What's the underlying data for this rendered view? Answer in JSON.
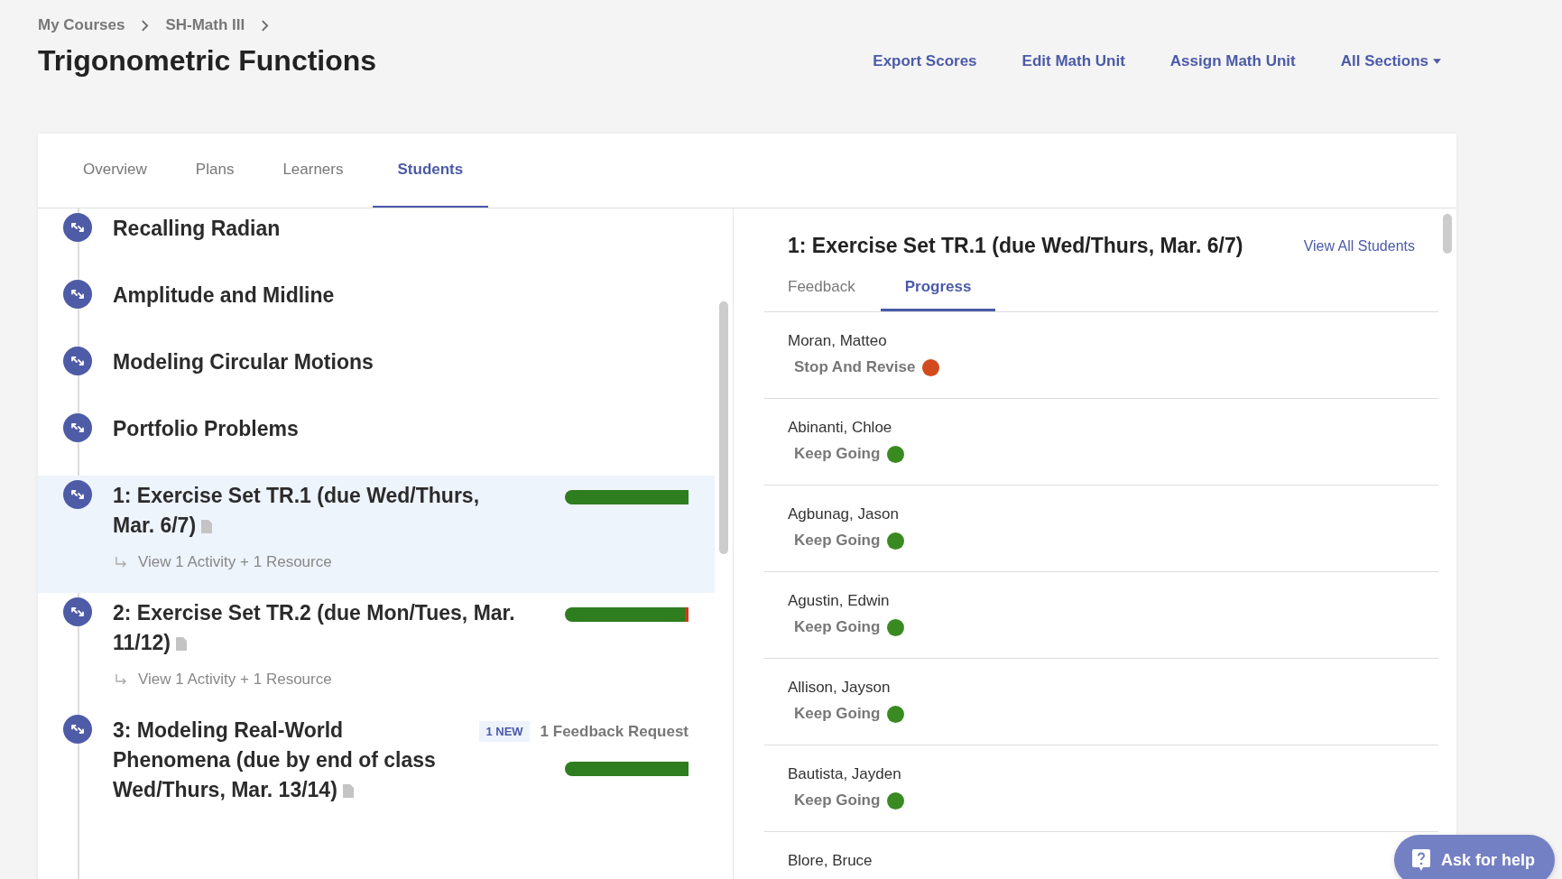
{
  "breadcrumb": [
    {
      "label": "My Courses"
    },
    {
      "label": "SH-Math III"
    }
  ],
  "title": "Trigonometric Functions",
  "actions": [
    {
      "label": "Export Scores",
      "kind": "link"
    },
    {
      "label": "Edit Math Unit",
      "kind": "link"
    },
    {
      "label": "Assign Math Unit",
      "kind": "link"
    },
    {
      "label": "All Sections",
      "kind": "dropdown"
    }
  ],
  "tabs": [
    {
      "label": "Overview",
      "selected": false
    },
    {
      "label": "Plans",
      "selected": false
    },
    {
      "label": "Learners",
      "selected": false
    },
    {
      "label": "Students",
      "selected": true
    }
  ],
  "units": [
    {
      "title": "Recalling Radian",
      "selected": false
    },
    {
      "title": "Amplitude and Midline",
      "selected": false
    },
    {
      "title": "Modeling Circular Motions",
      "selected": false
    },
    {
      "title": "Portfolio Problems",
      "selected": false
    },
    {
      "title": "1: Exercise Set TR.1 (due Wed/Thurs, Mar. 6/7)",
      "selected": true,
      "document": true,
      "sub_link": "View 1 Activity + 1 Resource",
      "progress": [
        {
          "color": "#2e7d1f",
          "level": 1
        }
      ]
    },
    {
      "title": "2: Exercise Set TR.2 (due Mon/Tues, Mar. 11/12)",
      "selected": false,
      "document": true,
      "sub_link": "View 1 Activity + 1 Resource",
      "progress": [
        {
          "color": "#2e7d1f",
          "level": 0.97
        },
        {
          "color": "#d0391c",
          "level": 0.03
        }
      ]
    },
    {
      "title": "3: Modeling Real-World Phenomena (due by end of class Wed/Thurs, Mar. 13/14)",
      "selected": false,
      "document": true,
      "badge": "1 NEW",
      "note": "1 Feedback Request",
      "progress": [
        {
          "color": "#2e7d1f",
          "level": 1
        }
      ]
    }
  ],
  "detail": {
    "title": "1: Exercise Set TR.1 (due Wed/Thurs, Mar. 6/7)",
    "link": "View All Students",
    "tabs": [
      {
        "label": "Feedback",
        "selected": false
      },
      {
        "label": "Progress",
        "selected": true
      }
    ],
    "students": [
      {
        "name": "Moran, Matteo",
        "status": "Stop And Revise",
        "color": "#d24a1e"
      },
      {
        "name": "Abinanti, Chloe",
        "status": "Keep Going",
        "color": "#3a8a22"
      },
      {
        "name": "Agbunag, Jason",
        "status": "Keep Going",
        "color": "#3a8a22"
      },
      {
        "name": "Agustin, Edwin",
        "status": "Keep Going",
        "color": "#3a8a22"
      },
      {
        "name": "Allison, Jayson",
        "status": "Keep Going",
        "color": "#3a8a22"
      },
      {
        "name": "Bautista, Jayden",
        "status": "Keep Going",
        "color": "#3a8a22"
      },
      {
        "name": "Blore, Bruce"
      }
    ]
  },
  "help_button": "Ask for help"
}
